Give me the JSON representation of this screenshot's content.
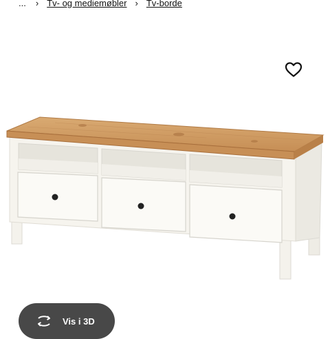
{
  "breadcrumb": {
    "ellipsis": "...",
    "items": [
      {
        "label": "Tv- og mediemøbler"
      },
      {
        "label": "Tv-borde"
      }
    ],
    "separator": "›"
  },
  "favorite": {
    "icon": "heart-outline-icon"
  },
  "product_image": {
    "description_icon": "tv-bench-image"
  },
  "view_3d": {
    "label": "Vis i 3D",
    "icon": "rotate-3d-icon",
    "background": "#484848"
  }
}
